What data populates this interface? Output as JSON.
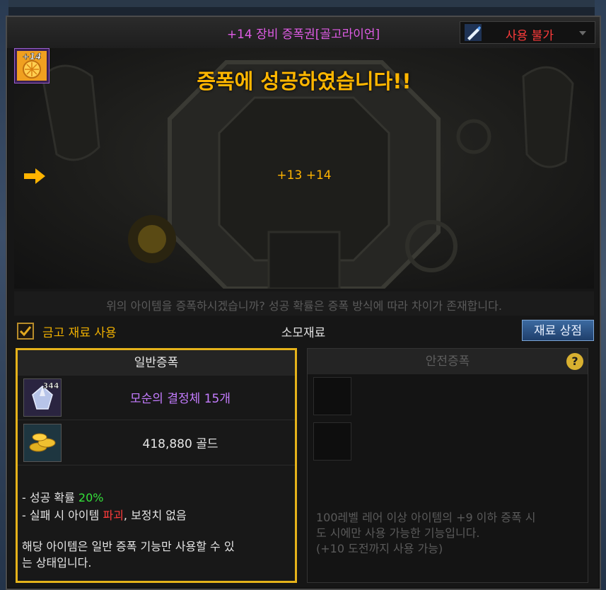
{
  "window": {
    "title": "+14 장비 증폭권[골고라이언]",
    "status": "사용 불가"
  },
  "result": {
    "message": "증폭에 성공하였습니다!!",
    "item_icon_badge": "+14",
    "from_level": "+13",
    "to_level": "+14"
  },
  "info_text": "위의 아이템을 증폭하시겠습니까? 성공 확률은 증폭 방식에 따라 차이가 존재합니다.",
  "options": {
    "checkbox_label": "금고 재료 사용",
    "checked": true,
    "materials_label": "소모재료",
    "shop_button": "재료 상점"
  },
  "normal_panel": {
    "header": "일반증폭",
    "materials": [
      {
        "name": "모순의 결정체",
        "quantity": "15개",
        "icon_badge": "344",
        "icon": "crystal-icon"
      },
      {
        "name": "418,880 골드",
        "quantity": "",
        "icon": "gold-coins-icon"
      }
    ],
    "note_success_prefix": "- 성공 확률 ",
    "note_success_value": "20%",
    "note_fail_prefix": "- 실패 시 아이템 ",
    "note_fail_value": "파괴",
    "note_fail_suffix": ", 보정치 없음",
    "description_line1": "해당 아이템은 일반 증폭 기능만 사용할 수 있",
    "description_line2": "는 상태입니다."
  },
  "safe_panel": {
    "header": "안전증폭",
    "help": "?",
    "description_line1": "100레벨 레어 이상 아이템의 +9 이하 증폭 시",
    "description_line2": "도 시에만 사용 가능한 기능입니다.",
    "description_line3": "(+10 도전까지 사용 가능)"
  },
  "colors": {
    "accent_gold": "#ffb600",
    "title_magenta": "#e05ce6",
    "error_red": "#ff3b3b",
    "success_green": "#34e13a",
    "material_purple": "#c47cff"
  }
}
